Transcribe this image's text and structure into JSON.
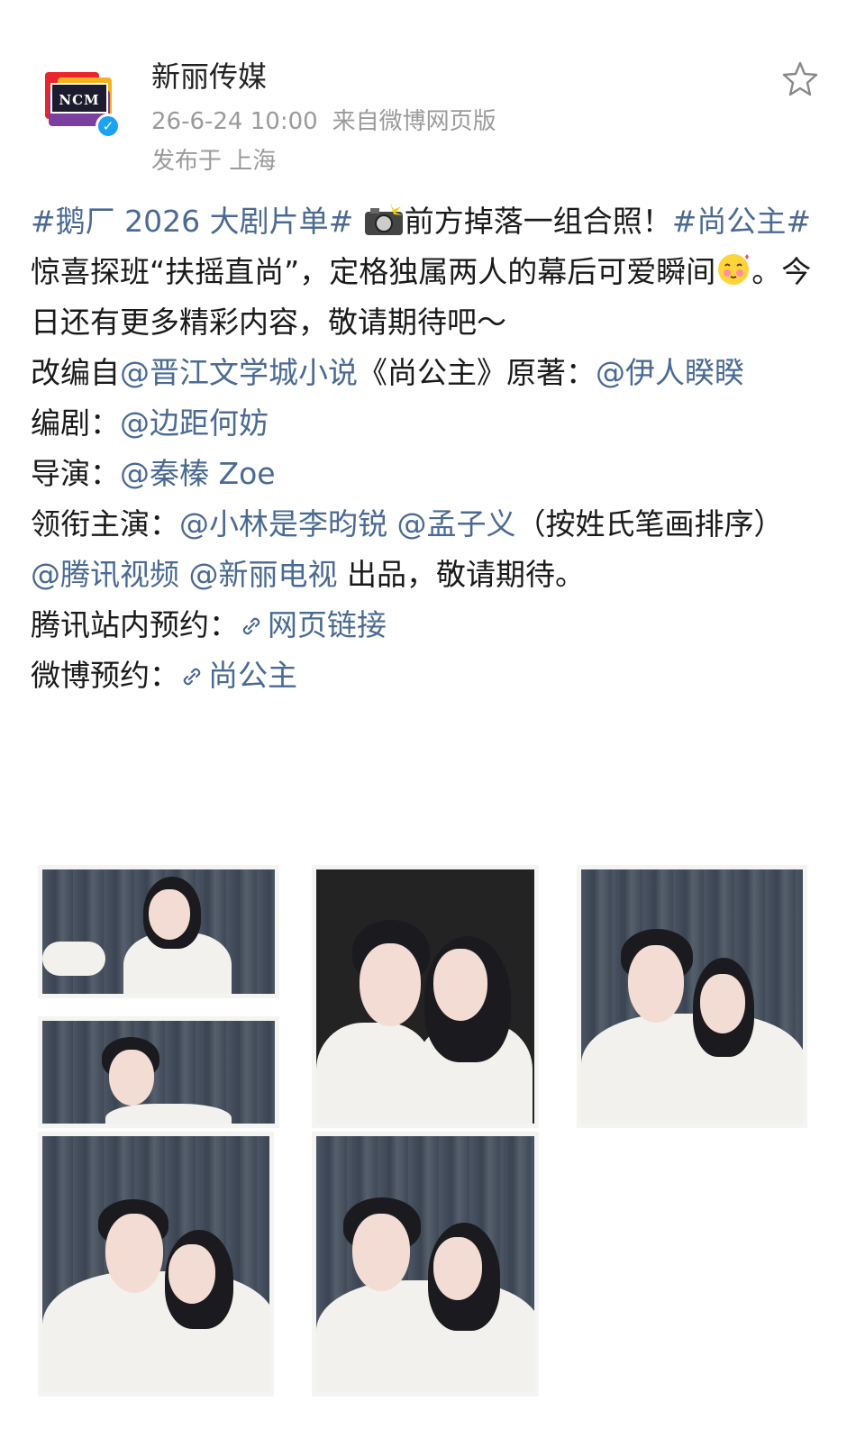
{
  "account": {
    "name": "新丽传媒",
    "logo_text": "NCM",
    "date": "26-6-24 10:00",
    "source": "来自微博网页版",
    "location": "发布于 上海"
  },
  "post": {
    "line1_topic": "#鹅厂 2026 大剧片单#",
    "line1_text": "前方掉落一组合照！",
    "line1_topic2": "#尚公主#",
    "line1_text2": " 惊喜探班“扶摇直尚”，定格独属两人的幕后可爱瞬间",
    "line1_text3": "。今日还有更多精彩内容，敬请期待吧～",
    "adapted_label": "改编自",
    "adapted_mention": "@晋江文学城小说",
    "adapted_title": "《尚公主》原著：",
    "author_mention": "@伊人睽睽",
    "writer_label": "编剧：",
    "writer_mention": "@边距何妨",
    "director_label": "导演：",
    "director_mention": "@秦榛 Zoe",
    "cast_label": "领衔主演：",
    "cast_mention1": "@小林是李昀锐",
    "cast_mention2": "@孟子义",
    "cast_note": "（按姓氏笔画排序）",
    "producer_mention1": "@腾讯视频",
    "producer_mention2": "@新丽电视",
    "producer_text": " 出品，敬请期待。",
    "tencent_label": "腾讯站内预约：",
    "tencent_link": "网页链接",
    "weibo_label": "微博预约：",
    "weibo_link": "尚公主"
  },
  "icons": {
    "favorite": "star-outline-icon",
    "verified": "verified-badge-icon",
    "camera_emoji": "camera-flash-icon",
    "shy_emoji": "shy-face-icon",
    "link": "link-icon"
  },
  "colors": {
    "link": "#4a6a94",
    "meta": "#9a9a9a",
    "verified": "#1da1f2"
  }
}
